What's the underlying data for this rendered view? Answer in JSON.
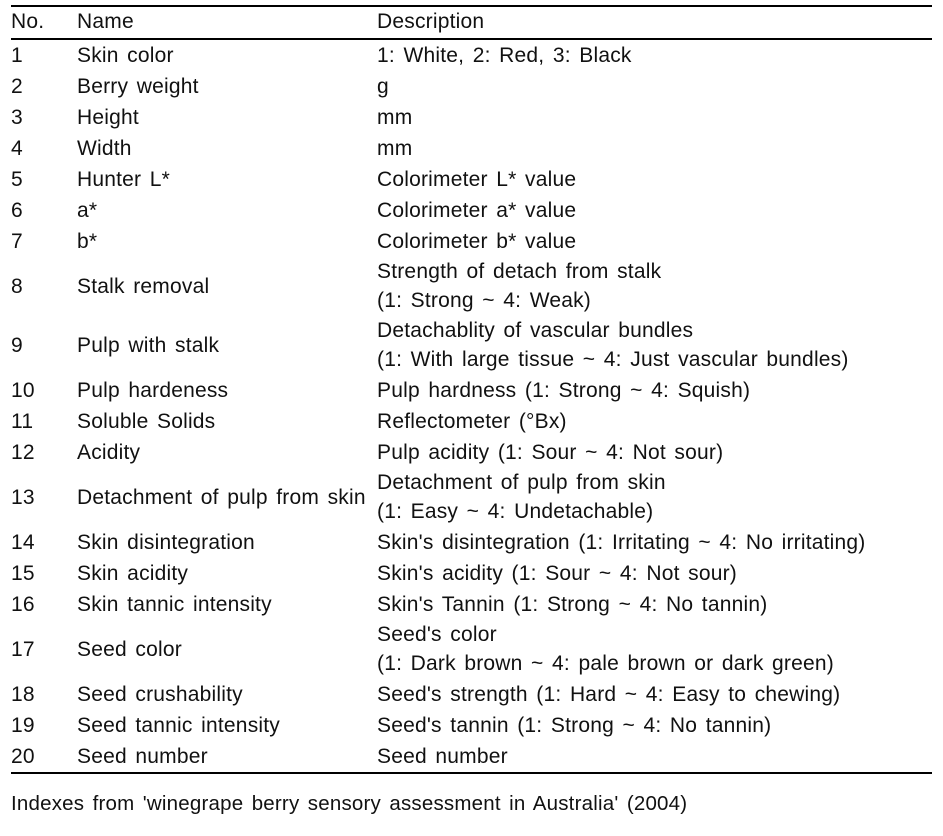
{
  "table": {
    "columns": {
      "no": "No.",
      "name": "Name",
      "description": "Description"
    },
    "rows": [
      {
        "no": "1",
        "name": "Skin color",
        "desc": [
          "1: White, 2: Red, 3: Black"
        ]
      },
      {
        "no": "2",
        "name": "Berry weight",
        "desc": [
          "g"
        ]
      },
      {
        "no": "3",
        "name": "Height",
        "desc": [
          "mm"
        ]
      },
      {
        "no": "4",
        "name": "Width",
        "desc": [
          "mm"
        ]
      },
      {
        "no": "5",
        "name": "Hunter L*",
        "desc": [
          "Colorimeter L* value"
        ]
      },
      {
        "no": "6",
        "name": "a*",
        "desc": [
          "Colorimeter a* value"
        ]
      },
      {
        "no": "7",
        "name": "b*",
        "desc": [
          "Colorimeter b* value"
        ]
      },
      {
        "no": "8",
        "name": "Stalk removal",
        "desc": [
          "Strength of detach from stalk",
          "(1:  Strong ~ 4: Weak)"
        ]
      },
      {
        "no": "9",
        "name": "Pulp with stalk",
        "desc": [
          "Detachablity of vascular bundles",
          "(1:  With large tissue ~ 4: Just vascular bundles)"
        ]
      },
      {
        "no": "10",
        "name": "Pulp hardeness",
        "desc": [
          "Pulp hardness (1: Strong ~ 4:  Squish)"
        ]
      },
      {
        "no": "11",
        "name": "Soluble Solids",
        "desc": [
          "Reflectometer (°Bx)"
        ]
      },
      {
        "no": "12",
        "name": "Acidity",
        "desc": [
          "Pulp acidity (1: Sour ~ 4: Not sour)"
        ]
      },
      {
        "no": "13",
        "name": "Detachment of pulp from skin",
        "desc": [
          "Detachment of pulp from skin",
          "(1:  Easy ~ 4: Undetachable)"
        ]
      },
      {
        "no": "14",
        "name": "Skin disintegration",
        "desc": [
          "Skin's disintegration (1: Irritating  ~ 4: No irritating)"
        ]
      },
      {
        "no": "15",
        "name": "Skin acidity",
        "desc": [
          "Skin's acidity (1: Sour ~ 4: Not  sour)"
        ]
      },
      {
        "no": "16",
        "name": "Skin tannic intensity",
        "desc": [
          "Skin's Tannin (1: Strong ~ 4: No  tannin)"
        ]
      },
      {
        "no": "17",
        "name": "Seed color",
        "desc": [
          "Seed's color",
          "(1: Dark brown ~ 4:  pale brown or dark green)"
        ]
      },
      {
        "no": "18",
        "name": "Seed crushability",
        "desc": [
          "Seed's strength (1: Hard ~ 4: Easy  to chewing)"
        ]
      },
      {
        "no": "19",
        "name": "Seed tannic intensity",
        "desc": [
          "Seed's tannin (1: Strong ~ 4: No  tannin)"
        ]
      },
      {
        "no": "20",
        "name": "Seed number",
        "desc": [
          "Seed number"
        ]
      }
    ]
  },
  "footnote": "Indexes from 'winegrape berry sensory assessment in Australia' (2004)"
}
